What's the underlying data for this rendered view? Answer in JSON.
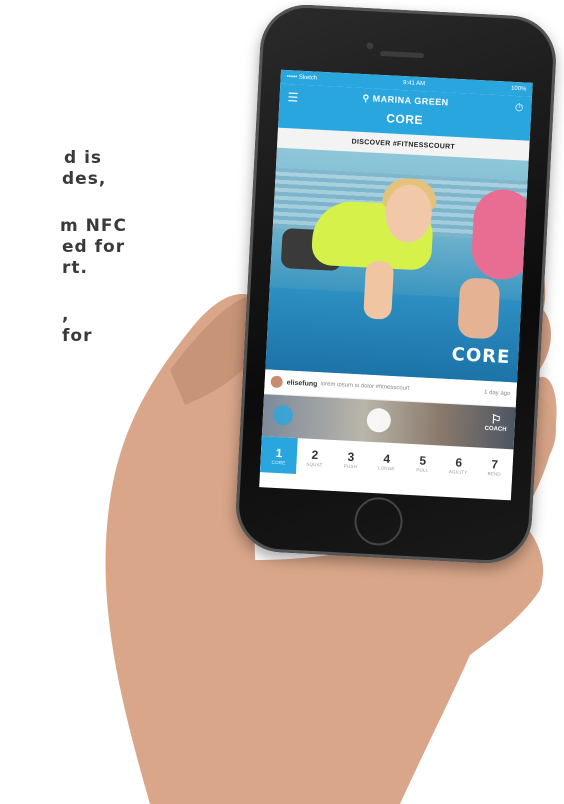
{
  "side_text": {
    "line1": "d is",
    "line2": "des,",
    "line3": "m NFC",
    "line4": "ed for",
    "line5": "rt.",
    "line6": ",",
    "line7": "for"
  },
  "status_bar": {
    "carrier": "••••• Sketch",
    "time": "9:41 AM",
    "battery": "100%"
  },
  "nav": {
    "menu_icon": "menu-icon",
    "location": "MARINA GREEN",
    "title": "CORE",
    "timer_icon": "stopwatch-icon"
  },
  "discover": {
    "label": "DISCOVER #FITNESSCOURT"
  },
  "hero": {
    "label": "CORE"
  },
  "post": {
    "user": "elisefung",
    "text": "lorem ipsum si dolor #fitnesscourt",
    "time": "1 day ago"
  },
  "video": {
    "coach_label": "COACH"
  },
  "tabs": [
    {
      "num": "1",
      "label": "CORE",
      "active": true
    },
    {
      "num": "2",
      "label": "SQUAT",
      "active": false
    },
    {
      "num": "3",
      "label": "PUSH",
      "active": false
    },
    {
      "num": "4",
      "label": "LUNGE",
      "active": false
    },
    {
      "num": "5",
      "label": "PULL",
      "active": false
    },
    {
      "num": "6",
      "label": "AGILITY",
      "active": false
    },
    {
      "num": "7",
      "label": "BEND",
      "active": false
    }
  ],
  "colors": {
    "accent": "#2aa6df",
    "text_dark": "#3a3a3a"
  }
}
